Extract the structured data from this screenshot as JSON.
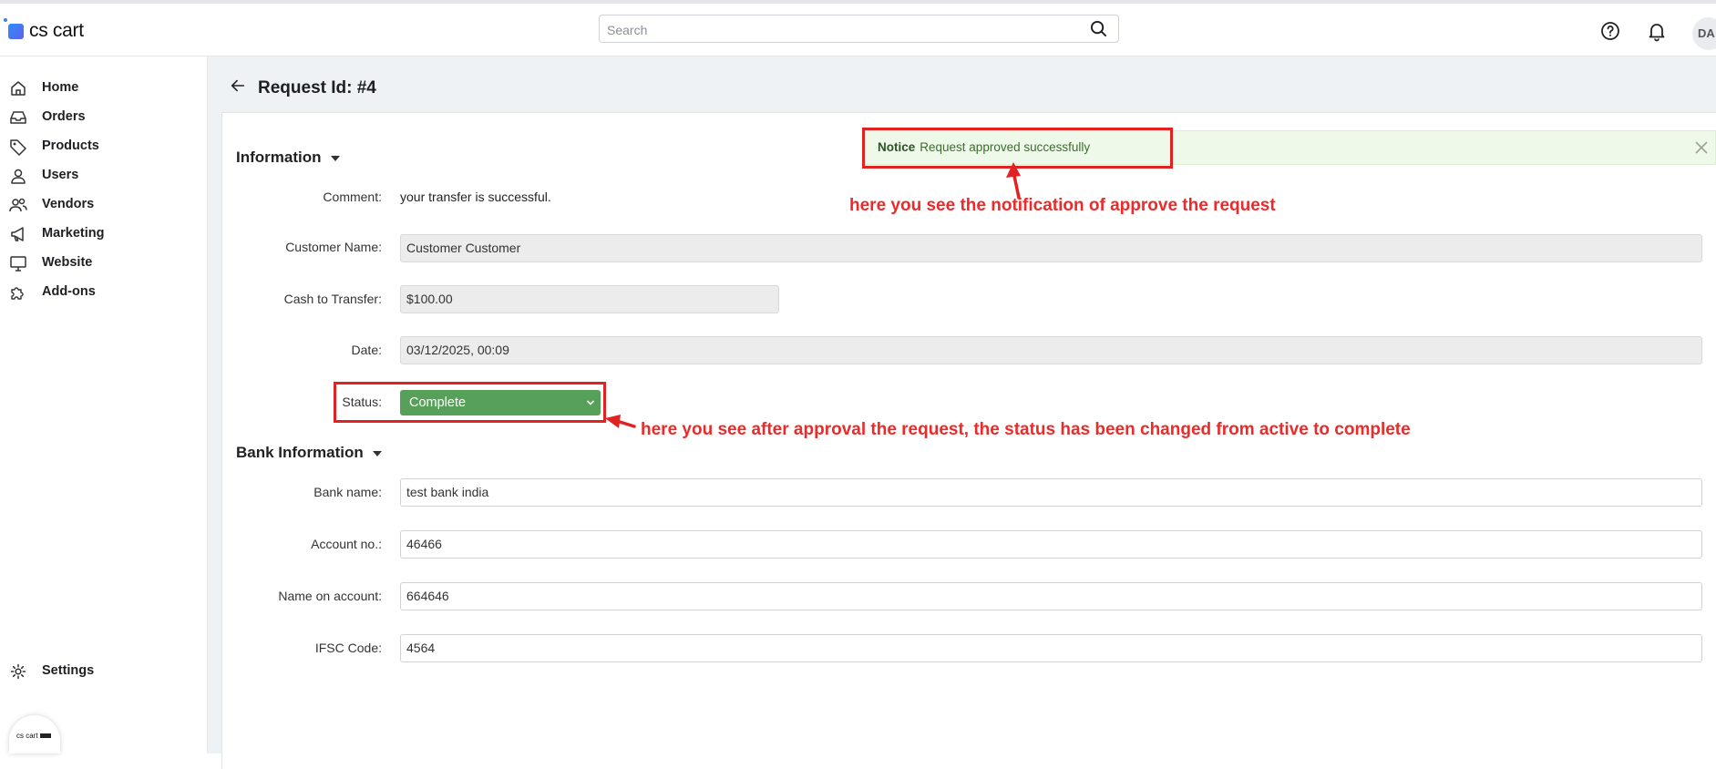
{
  "header": {
    "logo_text": "cs cart",
    "search_placeholder": "Search",
    "avatar_initials": "DA"
  },
  "sidebar": {
    "items": [
      {
        "label": "Home",
        "icon": "home-icon"
      },
      {
        "label": "Orders",
        "icon": "inbox-icon"
      },
      {
        "label": "Products",
        "icon": "tag-icon"
      },
      {
        "label": "Users",
        "icon": "user-icon"
      },
      {
        "label": "Vendors",
        "icon": "users-icon"
      },
      {
        "label": "Marketing",
        "icon": "megaphone-icon"
      },
      {
        "label": "Website",
        "icon": "monitor-icon"
      },
      {
        "label": "Add-ons",
        "icon": "puzzle-icon"
      }
    ],
    "settings_label": "Settings",
    "brand_mini": "cs cart"
  },
  "page": {
    "title": "Request Id: #4"
  },
  "notice": {
    "label": "Notice",
    "text": "Request approved successfully"
  },
  "information": {
    "title": "Information",
    "comment_label": "Comment:",
    "comment_value": "your transfer is successful.",
    "customer_label": "Customer Name:",
    "customer_value": "Customer Customer",
    "cash_label": "Cash to Transfer:",
    "cash_value": "$100.00",
    "date_label": "Date:",
    "date_value": "03/12/2025, 00:09",
    "status_label": "Status:",
    "status_value": "Complete"
  },
  "bank": {
    "title": "Bank Information",
    "bank_name_label": "Bank name:",
    "bank_name_value": "test bank india",
    "account_label": "Account no.:",
    "account_value": "46466",
    "name_on_account_label": "Name on account:",
    "name_on_account_value": "664646",
    "ifsc_label": "IFSC Code:",
    "ifsc_value": "4564"
  },
  "annotations": {
    "notice_note": "here you see the notification of approve the request",
    "status_note": "here you see after approval the request, the status has been changed from active to complete"
  },
  "colors": {
    "annotation_red": "#e02222",
    "status_green": "#57a05a",
    "notice_bg": "#eef9e9"
  }
}
